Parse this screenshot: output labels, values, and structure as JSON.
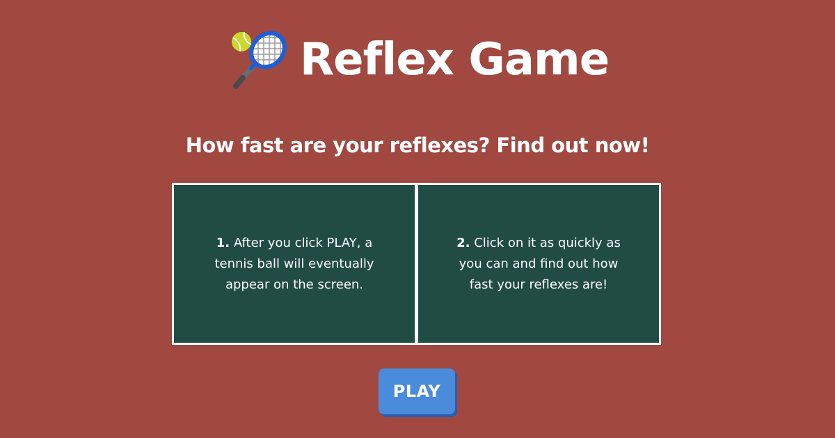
{
  "header": {
    "logo_icon": "tennis-racket-ball-icon",
    "title": "Reflex Game"
  },
  "subtitle": "How fast are your reflexes? Find out now!",
  "instructions": [
    {
      "number": "1.",
      "text": " After you click PLAY, a tennis ball will eventually appear on the screen."
    },
    {
      "number": "2.",
      "text": " Click on it as quickly as you can and find out how fast your reflexes are!"
    }
  ],
  "play_button": {
    "label": "PLAY"
  },
  "colors": {
    "background": "#a14840",
    "card_background": "#214c44",
    "card_border": "#ffffff",
    "button": "#4a8bdc",
    "button_shadow": "#2a5cb0",
    "text": "#ffffff"
  }
}
